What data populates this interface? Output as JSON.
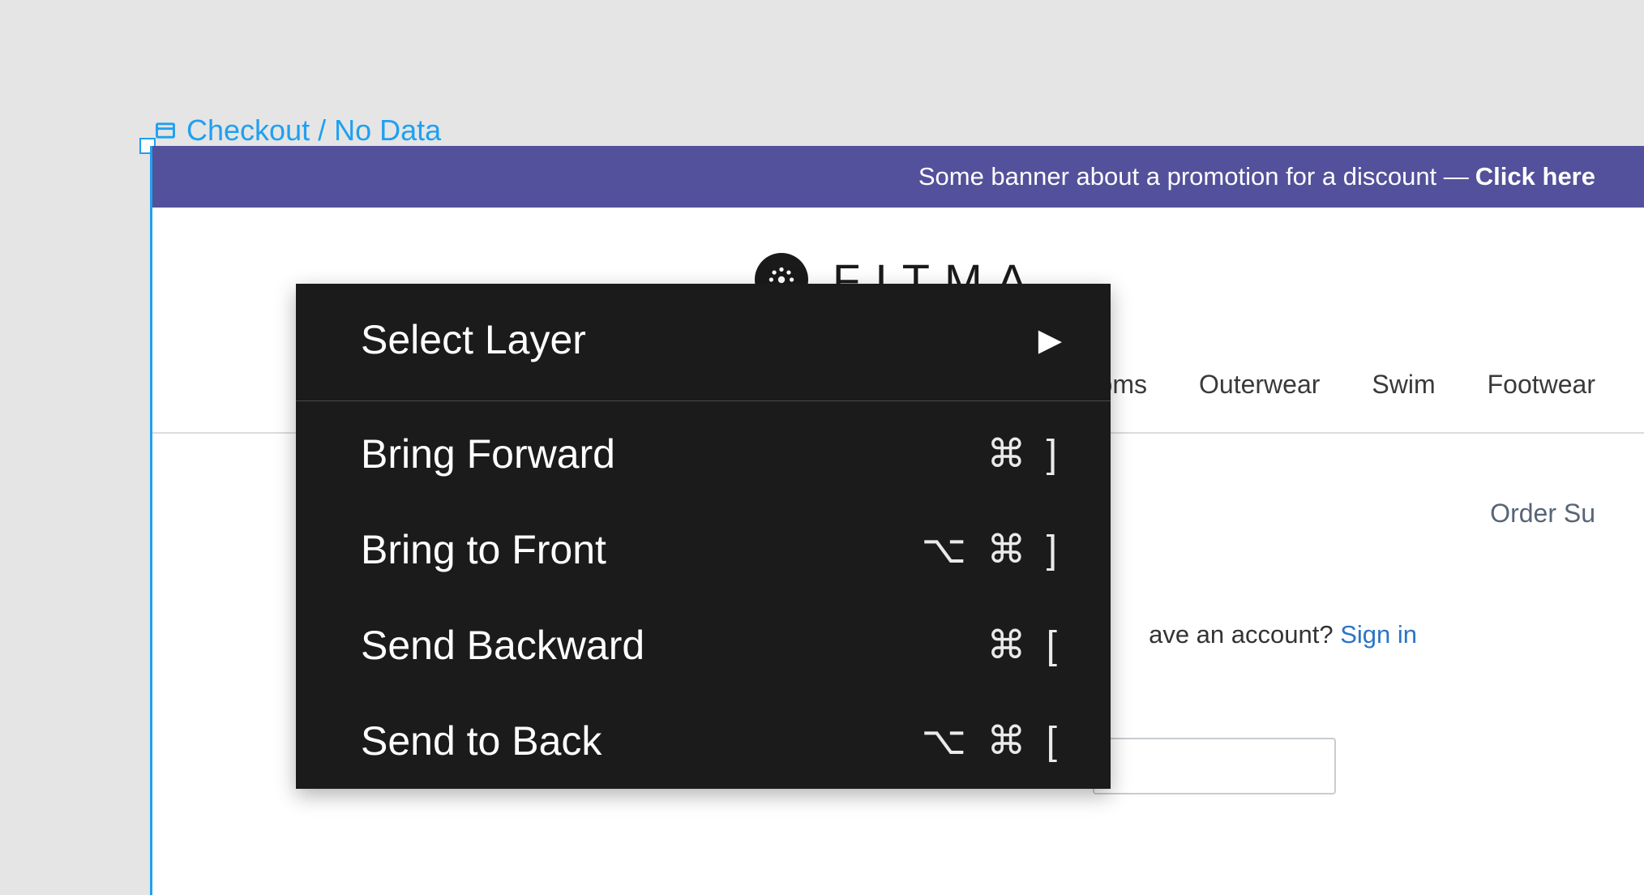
{
  "frame": {
    "label": "Checkout / No Data"
  },
  "banner": {
    "text": "Some banner about a promotion for a discount — ",
    "cta": "Click here"
  },
  "logo": {
    "text": "FITMA"
  },
  "nav": {
    "items": [
      "ottoms",
      "Outerwear",
      "Swim",
      "Footwear"
    ]
  },
  "content": {
    "order_summary": "Order Su",
    "account_prompt": "ave an account? ",
    "signin": "Sign in"
  },
  "context_menu": {
    "items": [
      {
        "label": "Select Layer",
        "shortcut": "",
        "submenu": true
      },
      {
        "label": "Bring Forward",
        "shortcut": "⌘ ]"
      },
      {
        "label": "Bring to Front",
        "shortcut": "⌥ ⌘ ]"
      },
      {
        "label": "Send Backward",
        "shortcut": "⌘ ["
      },
      {
        "label": "Send to Back",
        "shortcut": "⌥ ⌘ ["
      }
    ]
  }
}
